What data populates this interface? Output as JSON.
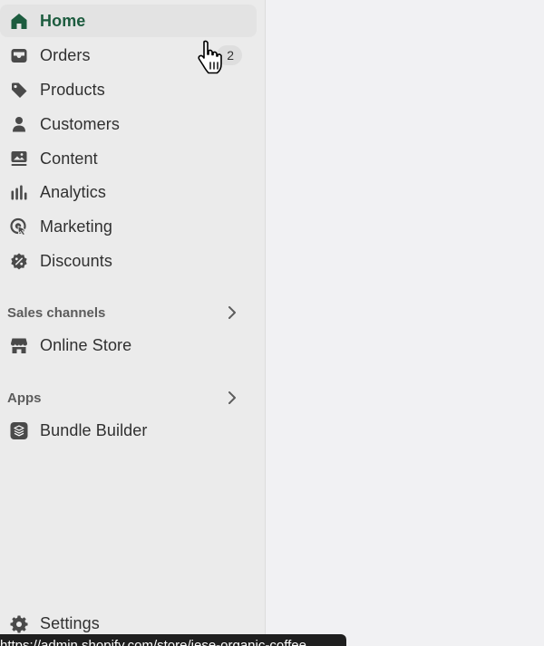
{
  "nav": {
    "items": [
      {
        "label": "Home",
        "icon": "home-icon",
        "active": true
      },
      {
        "label": "Orders",
        "icon": "inbox-icon",
        "badge": "2"
      },
      {
        "label": "Products",
        "icon": "tag-icon"
      },
      {
        "label": "Customers",
        "icon": "person-icon"
      },
      {
        "label": "Content",
        "icon": "image-icon"
      },
      {
        "label": "Analytics",
        "icon": "bar-chart-icon"
      },
      {
        "label": "Marketing",
        "icon": "target-icon"
      },
      {
        "label": "Discounts",
        "icon": "discount-icon"
      }
    ]
  },
  "sales_channels": {
    "header": "Sales channels",
    "items": [
      {
        "label": "Online Store",
        "icon": "store-icon"
      }
    ]
  },
  "apps": {
    "header": "Apps",
    "items": [
      {
        "label": "Bundle Builder",
        "icon": "bundle-app-icon"
      }
    ]
  },
  "settings": {
    "label": "Settings",
    "icon": "gear-icon"
  },
  "status_bar": {
    "url": "https://admin.shopify.com/store/iese-organic-coffee"
  },
  "colors": {
    "active_green": "#1d5c3f",
    "icon_gray": "#4a4a4a",
    "sidebar_bg": "#ebebeb",
    "main_bg": "#f1f1f3"
  }
}
